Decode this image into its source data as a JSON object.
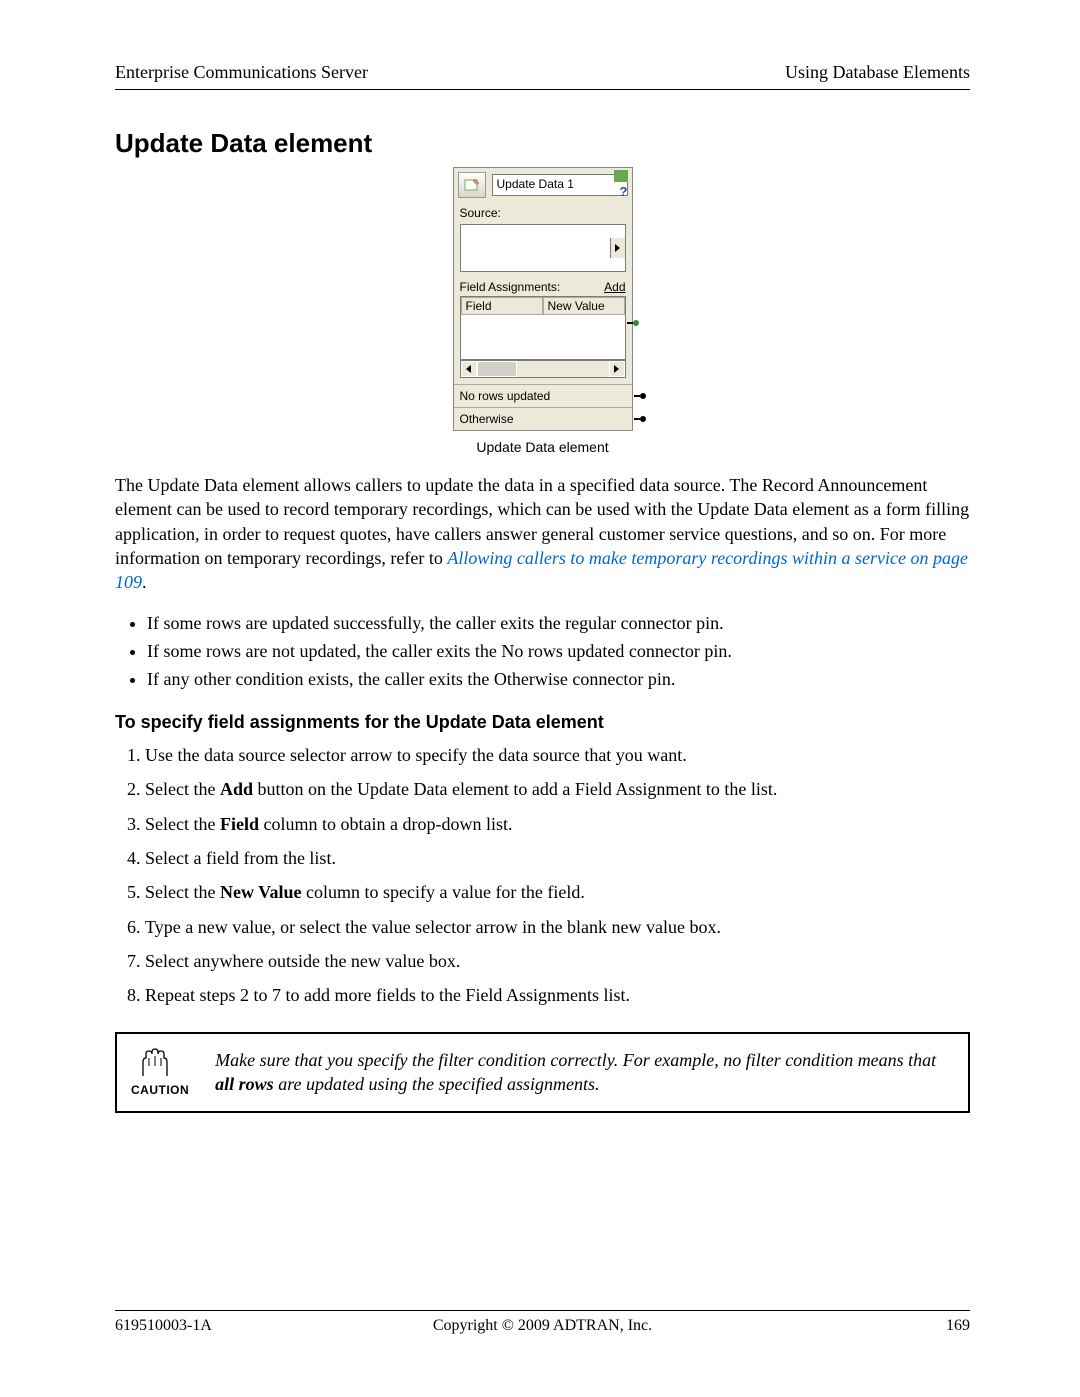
{
  "header": {
    "left": "Enterprise Communications Server",
    "right": "Using Database Elements"
  },
  "section_title": "Update Data element",
  "element_panel": {
    "title": "Update Data 1",
    "source_label": "Source:",
    "fa_label": "Field Assignments:",
    "add_label": "Add",
    "columns": {
      "field": "Field",
      "new_value": "New Value"
    },
    "out_no_rows": "No rows updated",
    "out_otherwise": "Otherwise",
    "caption": "Update Data element"
  },
  "paragraph": {
    "pre": "The Update Data element allows callers to update the data in a specified data source. The Record Announcement element can be used to record temporary recordings, which can be used with the Update Data element as a form filling application, in order to request quotes, have callers answer general customer service questions, and so on. For more information on temporary recordings, refer to ",
    "link": "Allowing callers to make temporary recordings within a service on page 109",
    "post": "."
  },
  "bullets": [
    "If some rows are updated successfully, the caller exits the regular connector pin.",
    "If some rows are not updated, the caller exits the No rows updated connector pin.",
    "If any other condition exists, the caller exits the Otherwise connector pin."
  ],
  "sub_heading": "To specify field assignments for the Update Data element",
  "steps": [
    {
      "pre": "Use the data source selector arrow to specify the data source that you want."
    },
    {
      "pre": "Select the ",
      "b": "Add",
      "post": " button on the Update Data element to add a Field Assignment to the list."
    },
    {
      "pre": "Select the ",
      "b": "Field",
      "post": " column to obtain a drop-down list."
    },
    {
      "pre": "Select a field from the list."
    },
    {
      "pre": "Select the ",
      "b": "New Value",
      "post": " column to specify a value for the field."
    },
    {
      "pre": "Type a new value, or select the value selector arrow in the blank new value box."
    },
    {
      "pre": "Select anywhere outside the new value box."
    },
    {
      "pre": "Repeat steps 2 to 7 to add more fields to the Field Assignments list."
    }
  ],
  "caution": {
    "label": "CAUTION",
    "pre": "Make sure that you specify the filter condition correctly. For example, no filter condition means that ",
    "b": "all rows",
    "post": " are updated using the specified assignments."
  },
  "footer": {
    "left": "619510003-1A",
    "center": "Copyright © 2009 ADTRAN, Inc.",
    "right": "169"
  }
}
